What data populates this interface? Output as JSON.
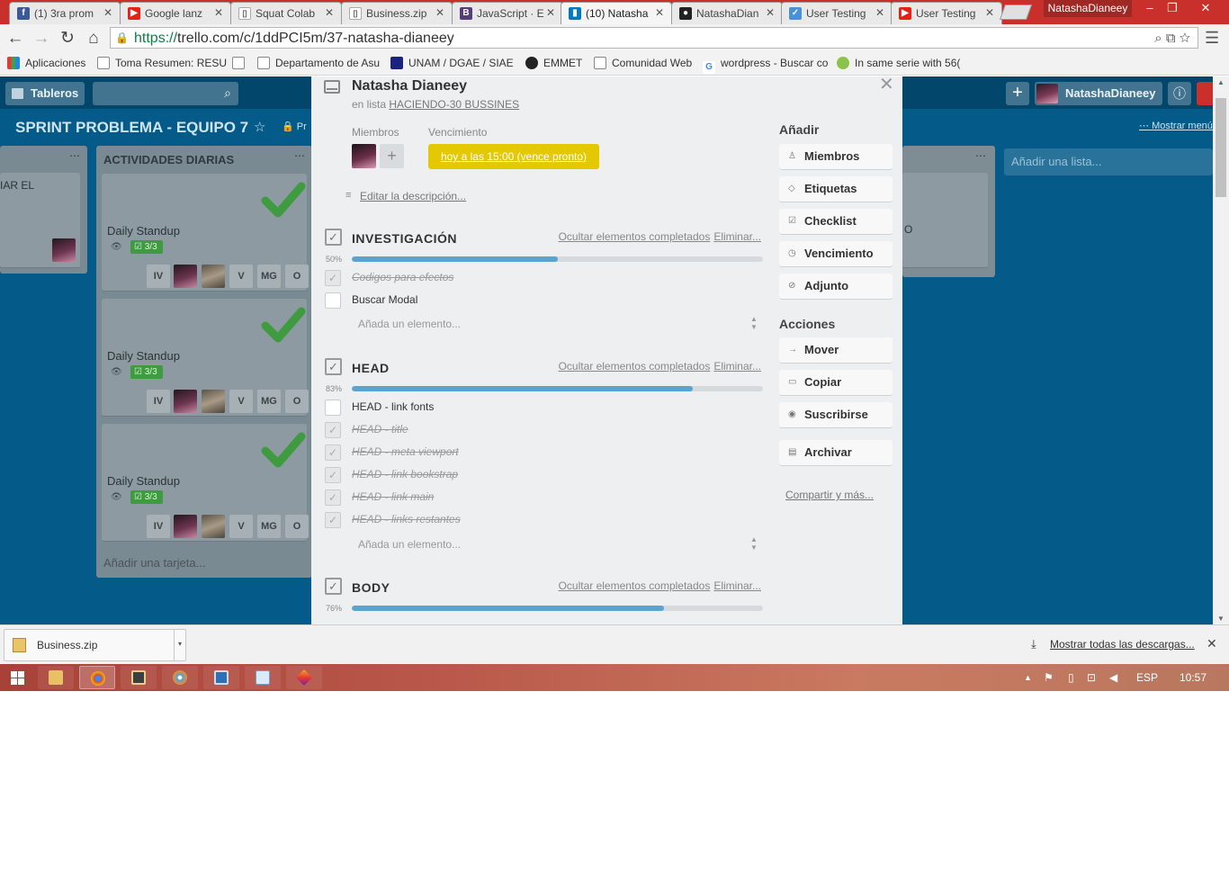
{
  "browser": {
    "tabs": [
      {
        "title": "(1) 3ra prom",
        "icon_bg": "#3b5998",
        "icon_glyph": "f"
      },
      {
        "title": "Google lanz",
        "icon_bg": "#e62117",
        "icon_glyph": "▶"
      },
      {
        "title": "Squat Colab",
        "icon_bg": "#ffffff",
        "icon_glyph": "▯"
      },
      {
        "title": "Business.zip",
        "icon_bg": "#ffffff",
        "icon_glyph": "▯"
      },
      {
        "title": "JavaScript · E",
        "icon_bg": "#563d7c",
        "icon_glyph": "B"
      },
      {
        "title": "(10) Natasha",
        "icon_bg": "#0079bf",
        "icon_glyph": "▮"
      },
      {
        "title": "NatashaDian",
        "icon_bg": "#222222",
        "icon_glyph": "●"
      },
      {
        "title": "User Testing",
        "icon_bg": "#4a90d9",
        "icon_glyph": "✓"
      },
      {
        "title": "User Testing",
        "icon_bg": "#e62117",
        "icon_glyph": "▶"
      }
    ],
    "user_badge": "NatashaDianeey",
    "url_protocol": "https://",
    "url_rest": "trello.com/c/1ddPCI5m/37-natasha-dianeey",
    "bookmarks": [
      {
        "label": "Aplicaciones",
        "icon": "apps-icon"
      },
      {
        "label": "Toma Resumen: RESU",
        "icon": "page-icon"
      },
      {
        "label": "",
        "icon": "page-icon"
      },
      {
        "label": "Departamento de Asu",
        "icon": "page-icon"
      },
      {
        "label": "UNAM / DGAE / SIAE",
        "icon": "unam-icon"
      },
      {
        "label": "EMMET",
        "icon": "emmet-icon"
      },
      {
        "label": "Comunidad Web",
        "icon": "page-icon"
      },
      {
        "label": "wordpress - Buscar co",
        "icon": "google-icon"
      },
      {
        "label": "In same serie with 56(",
        "icon": "serie-icon"
      }
    ]
  },
  "board": {
    "boards_label": "Tableros",
    "title": "SPRINT PROBLEMA - EQUIPO 7",
    "privacy_label": "Pr",
    "member_name": "NatashaDianeey",
    "show_menu": "Mostrar menú",
    "left_list_partial": "IAR EL",
    "list_title": "ACTIVIDADES DIARIAS",
    "cards": [
      {
        "title": "Daily Standup",
        "badge": "3/3",
        "members": [
          "IV",
          "",
          "",
          "V",
          "MG",
          "O"
        ]
      },
      {
        "title": "Daily Standup",
        "badge": "3/3",
        "members": [
          "IV",
          "",
          "",
          "V",
          "MG",
          "O"
        ]
      },
      {
        "title": "Daily Standup",
        "badge": "3/3",
        "members": [
          "IV",
          "",
          "",
          "V",
          "MG",
          "O"
        ]
      }
    ],
    "add_card": "Añadir una tarjeta...",
    "right_list_partial": "O",
    "add_list": "Añadir una lista..."
  },
  "modal": {
    "title": "Natasha Dianeey",
    "in_list_prefix": "en lista",
    "list_link": "HACIENDO-30 BUSSINES",
    "members_label": "Miembros",
    "due_label": "Vencimiento",
    "due_value": "hoy a las 15:00 (vence pronto)",
    "edit_description": "Editar la descripción...",
    "hide_completed": "Ocultar elementos completados",
    "delete": "Eliminar...",
    "add_item_placeholder": "Añada un elemento...",
    "checklists": [
      {
        "title": "INVESTIGACIÓN",
        "percent_label": "50%",
        "progress": 0.5,
        "items": [
          {
            "text": "Codigos para efectos",
            "done": true
          },
          {
            "text": "Buscar Modal",
            "done": false
          }
        ]
      },
      {
        "title": "HEAD",
        "percent_label": "83%",
        "progress": 0.83,
        "items": [
          {
            "text": "HEAD - link fonts",
            "done": false
          },
          {
            "text": "HEAD - title",
            "done": true
          },
          {
            "text": "HEAD - meta viewport",
            "done": true
          },
          {
            "text": "HEAD - link bookstrap",
            "done": true
          },
          {
            "text": "HEAD - link main",
            "done": true
          },
          {
            "text": "HEAD - links restantes",
            "done": true
          }
        ]
      },
      {
        "title": "BODY",
        "percent_label": "76%",
        "progress": 0.76,
        "items": []
      }
    ],
    "sidebar": {
      "add_heading": "Añadir",
      "add_buttons": [
        {
          "label": "Miembros",
          "icon": "person-icon"
        },
        {
          "label": "Etiquetas",
          "icon": "tag-icon"
        },
        {
          "label": "Checklist",
          "icon": "checkbox-icon"
        },
        {
          "label": "Vencimiento",
          "icon": "clock-icon"
        },
        {
          "label": "Adjunto",
          "icon": "paperclip-icon"
        }
      ],
      "actions_heading": "Acciones",
      "action_buttons": [
        {
          "label": "Mover",
          "icon": "arrow-right-icon"
        },
        {
          "label": "Copiar",
          "icon": "copy-icon"
        },
        {
          "label": "Suscribirse",
          "icon": "eye-icon"
        }
      ],
      "archive": {
        "label": "Archivar",
        "icon": "archive-icon"
      },
      "share": "Compartir y más..."
    }
  },
  "downloads": {
    "file": "Business.zip",
    "show_all": "Mostrar todas las descargas..."
  },
  "taskbar": {
    "language": "ESP",
    "time": "10:57"
  },
  "colors": {
    "board_bg": "#045b8a",
    "due_badge": "#e5c900",
    "progress": "#5ba4cf",
    "tabstrip": "#c9302c"
  }
}
